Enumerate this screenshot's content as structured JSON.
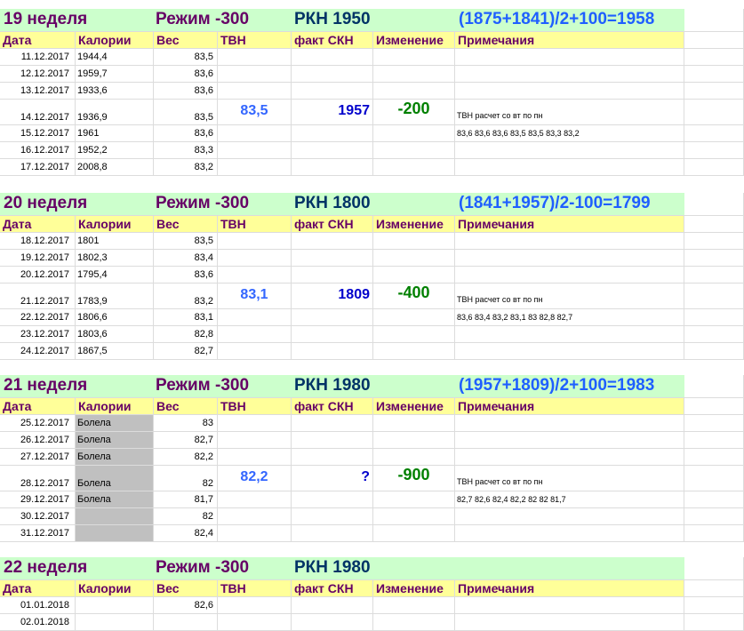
{
  "headers": {
    "date": "Дата",
    "cal": "Калории",
    "ves": "Вес",
    "tvn": "ТВН",
    "fact": "факт СКН",
    "chg": "Изменение",
    "notes": "Примечания"
  },
  "weeks": [
    {
      "week": "19 неделя",
      "mode": "Режим -300",
      "rkn": "РКН 1950",
      "formula": "(1875+1841)/2+100=1958",
      "rows": [
        {
          "date": "11.12.2017",
          "cal": "1944,4",
          "ves": "83,5"
        },
        {
          "date": "12.12.2017",
          "cal": "1959,7",
          "ves": "83,6"
        },
        {
          "date": "13.12.2017",
          "cal": "1933,6",
          "ves": "83,6"
        },
        {
          "date": "14.12.2017",
          "cal": "1936,9",
          "ves": "83,5",
          "tvn": "83,5",
          "fact": "1957",
          "chg": "-200",
          "note": "ТВН расчет со вт по пн"
        },
        {
          "date": "15.12.2017",
          "cal": "1961",
          "ves": "83,6",
          "note": "83,6  83,6  83,6  83,5  83,5  83,3  83,2"
        },
        {
          "date": "16.12.2017",
          "cal": "1952,2",
          "ves": "83,3"
        },
        {
          "date": "17.12.2017",
          "cal": "2008,8",
          "ves": "83,2"
        }
      ]
    },
    {
      "week": "20  неделя",
      "mode": "Режим -300",
      "rkn": "РКН 1800",
      "formula": "(1841+1957)/2-100=1799",
      "rows": [
        {
          "date": "18.12.2017",
          "cal": "1801",
          "ves": "83,5"
        },
        {
          "date": "19.12.2017",
          "cal": "1802,3",
          "ves": "83,4"
        },
        {
          "date": "20.12.2017",
          "cal": "1795,4",
          "ves": "83,6"
        },
        {
          "date": "21.12.2017",
          "cal": "1783,9",
          "ves": "83,2",
          "tvn": "83,1",
          "fact": "1809",
          "chg": "-400",
          "note": "ТВН расчет со вт по пн"
        },
        {
          "date": "22.12.2017",
          "cal": "1806,6",
          "ves": "83,1",
          "note": "83,6  83,4  83,2  83,1  83  82,8  82,7"
        },
        {
          "date": "23.12.2017",
          "cal": "1803,6",
          "ves": "82,8"
        },
        {
          "date": "24.12.2017",
          "cal": "1867,5",
          "ves": "82,7"
        }
      ]
    },
    {
      "week": "21  неделя",
      "mode": "Режим -300",
      "rkn": "РКН  1980",
      "formula": "(1957+1809)/2+100=1983",
      "rows": [
        {
          "date": "25.12.2017",
          "cal": "Болела",
          "ves": "83",
          "gray": true
        },
        {
          "date": "26.12.2017",
          "cal": "Болела",
          "ves": "82,7",
          "gray": true
        },
        {
          "date": "27.12.2017",
          "cal": "Болела",
          "ves": "82,2",
          "gray": true
        },
        {
          "date": "28.12.2017",
          "cal": "Болела",
          "ves": "82",
          "gray": true,
          "tvn": "82,2",
          "fact": "?",
          "chg": "-900",
          "note": "ТВН расчет со вт по пн"
        },
        {
          "date": "29.12.2017",
          "cal": "Болела",
          "ves": "81,7",
          "gray": true,
          "note": "82,7  82,6  82,4  82,2  82  82  81,7"
        },
        {
          "date": "30.12.2017",
          "cal": "",
          "ves": "82",
          "gray": true
        },
        {
          "date": "31.12.2017",
          "cal": "",
          "ves": "82,4",
          "gray": true
        }
      ]
    },
    {
      "week": "22  неделя",
      "mode": "Режим -300",
      "rkn": "РКН  1980",
      "formula": "",
      "rows": [
        {
          "date": "01.01.2018",
          "cal": "",
          "ves": "82,6"
        },
        {
          "date": "02.01.2018",
          "cal": "",
          "ves": ""
        }
      ]
    }
  ]
}
